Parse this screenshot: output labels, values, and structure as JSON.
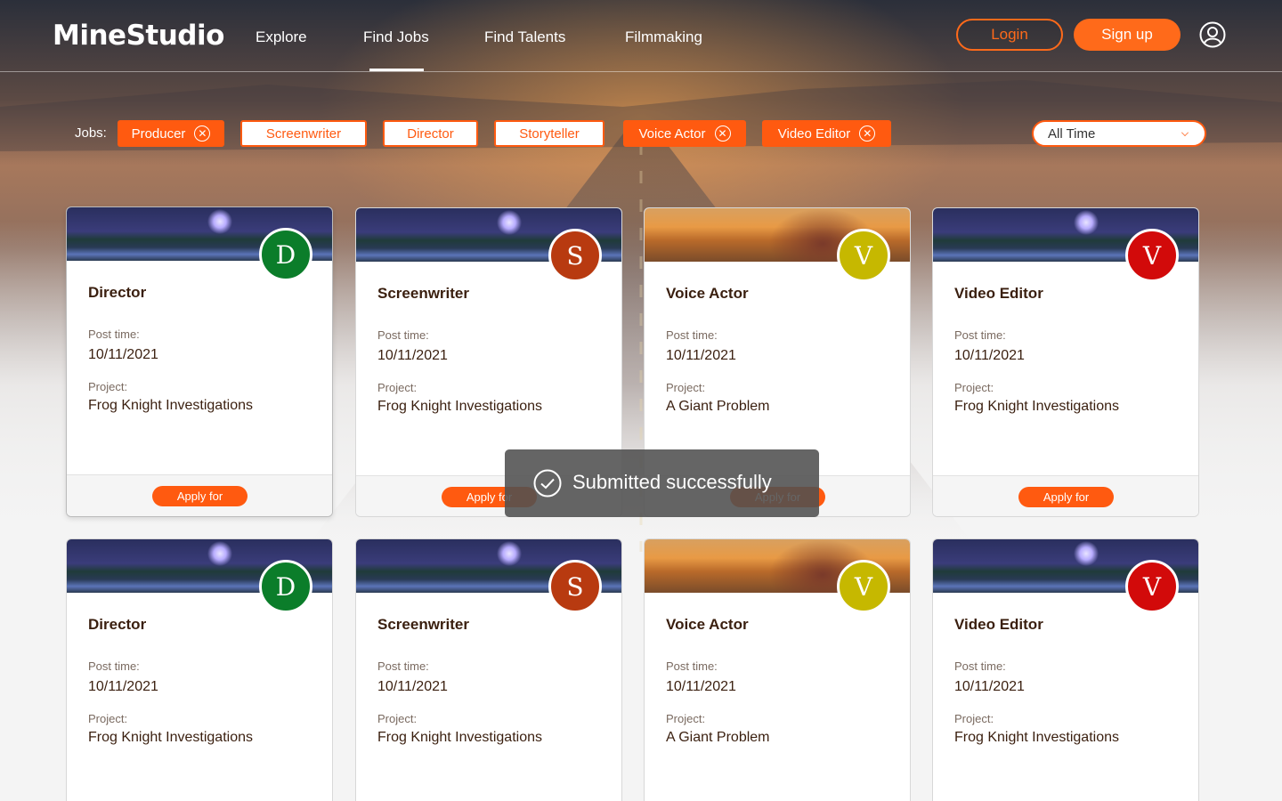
{
  "header": {
    "logo": "MineStudio",
    "nav": [
      "Explore",
      "Find Jobs",
      "Find Talents",
      "Filmmaking"
    ],
    "active_nav": "Find Jobs",
    "login_label": "Login",
    "signup_label": "Sign up",
    "user_icon": "user-circle-icon"
  },
  "filters": {
    "jobs_label": "Jobs:",
    "chips": [
      {
        "label": "Producer",
        "active": true
      },
      {
        "label": "Screenwriter",
        "active": false
      },
      {
        "label": "Director",
        "active": false
      },
      {
        "label": "Storyteller",
        "active": false
      },
      {
        "label": "Voice Actor",
        "active": true
      },
      {
        "label": "Video Editor",
        "active": true
      }
    ],
    "time_select": "All Time"
  },
  "labels": {
    "post_time": "Post time:",
    "project": "Project:",
    "apply": "Apply for"
  },
  "cards": [
    {
      "title": "Director",
      "initial": "D",
      "color": "#0b7d2a",
      "post_time": "10/11/2021",
      "project": "Frog Knight Investigations",
      "thumb": "night"
    },
    {
      "title": "Screenwriter",
      "initial": "S",
      "color": "#b83a10",
      "post_time": "10/11/2021",
      "project": "Frog Knight Investigations",
      "thumb": "night"
    },
    {
      "title": "Voice Actor",
      "initial": "V",
      "color": "#c6b800",
      "post_time": "10/11/2021",
      "project": "A Giant Problem",
      "thumb": "day"
    },
    {
      "title": "Video Editor",
      "initial": "V",
      "color": "#d20a0a",
      "post_time": "10/11/2021",
      "project": "Frog Knight Investigations",
      "thumb": "night"
    },
    {
      "title": "Director",
      "initial": "D",
      "color": "#0b7d2a",
      "post_time": "10/11/2021",
      "project": "Frog Knight Investigations",
      "thumb": "night"
    },
    {
      "title": "Screenwriter",
      "initial": "S",
      "color": "#b83a10",
      "post_time": "10/11/2021",
      "project": "Frog Knight Investigations",
      "thumb": "night"
    },
    {
      "title": "Voice Actor",
      "initial": "V",
      "color": "#c6b800",
      "post_time": "10/11/2021",
      "project": "A Giant Problem",
      "thumb": "day"
    },
    {
      "title": "Video Editor",
      "initial": "V",
      "color": "#d20a0a",
      "post_time": "10/11/2021",
      "project": "Frog Knight Investigations",
      "thumb": "night"
    }
  ],
  "toast": {
    "message": "Submitted successfully",
    "icon": "check-circle-icon"
  },
  "colors": {
    "accent": "#ff5a10",
    "text_dark": "#3a1f0f"
  }
}
